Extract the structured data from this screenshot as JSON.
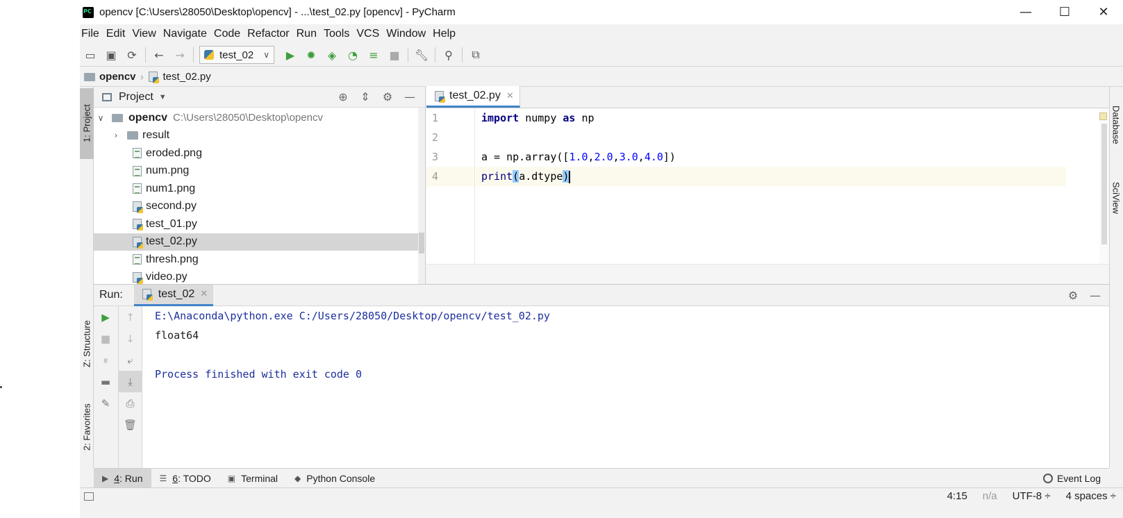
{
  "window": {
    "title": "opencv [C:\\Users\\28050\\Desktop\\opencv] - ...\\test_02.py [opencv] - PyCharm",
    "minimize": "—",
    "maximize": "☐",
    "close": "✕"
  },
  "menu": [
    "File",
    "Edit",
    "View",
    "Navigate",
    "Code",
    "Refactor",
    "Run",
    "Tools",
    "VCS",
    "Window",
    "Help"
  ],
  "toolbar": {
    "run_config": "test_02"
  },
  "breadcrumb": {
    "project": "opencv",
    "file": "test_02.py"
  },
  "left_strip": {
    "project_tab": "1: Project",
    "structure_tab": "Z: Structure",
    "favorites_tab": "2: Favorites"
  },
  "right_strip": {
    "database_tab": "Database",
    "sciview_tab": "SciView"
  },
  "project_panel": {
    "title": "Project",
    "root": {
      "name": "opencv",
      "path": "C:\\Users\\28050\\Desktop\\opencv"
    },
    "items": [
      {
        "name": "result",
        "type": "folder"
      },
      {
        "name": "eroded.png",
        "type": "image"
      },
      {
        "name": "num.png",
        "type": "image"
      },
      {
        "name": "num1.png",
        "type": "image"
      },
      {
        "name": "second.py",
        "type": "python"
      },
      {
        "name": "test_01.py",
        "type": "python"
      },
      {
        "name": "test_02.py",
        "type": "python",
        "selected": true
      },
      {
        "name": "thresh.png",
        "type": "image"
      },
      {
        "name": "video.py",
        "type": "python"
      }
    ]
  },
  "editor": {
    "tab": "test_02.py",
    "line_numbers": [
      "1",
      "2",
      "3",
      "4"
    ],
    "code": {
      "l1_kw": "import",
      "l1_mid": " numpy ",
      "l1_as": "as",
      "l1_end": " np",
      "l3_a": "a = np.array([",
      "l3_n1": "1.0",
      "l3_n2": "2.0",
      "l3_n3": "3.0",
      "l3_n4": "4.0",
      "l3_end": "])",
      "l4_print": "print",
      "l4_open": "(",
      "l4_mid": "a.dtype",
      "l4_close": ")"
    }
  },
  "run_panel": {
    "label": "Run:",
    "tab": "test_02",
    "output": [
      "E:\\Anaconda\\python.exe C:/Users/28050/Desktop/opencv/test_02.py",
      "float64",
      "",
      "Process finished with exit code 0"
    ]
  },
  "bottom_tabs": {
    "run": {
      "num": "4",
      "label": ": Run"
    },
    "todo": {
      "num": "6",
      "label": ": TODO"
    },
    "terminal": "Terminal",
    "python_console": "Python Console",
    "event_log": "Event Log"
  },
  "status": {
    "position": "4:15",
    "line_sep": "n/a",
    "encoding": "UTF-8 ÷",
    "indent": "4 spaces ÷"
  }
}
